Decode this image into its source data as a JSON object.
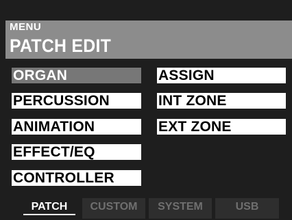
{
  "header": {
    "menu_label": "MENU",
    "page_title": "PATCH EDIT"
  },
  "menu": {
    "left": [
      {
        "label": "ORGAN",
        "selected": true
      },
      {
        "label": "PERCUSSION",
        "selected": false
      },
      {
        "label": "ANIMATION",
        "selected": false
      },
      {
        "label": "EFFECT/EQ",
        "selected": false
      },
      {
        "label": "CONTROLLER",
        "selected": false
      }
    ],
    "right": [
      {
        "label": "ASSIGN",
        "selected": false
      },
      {
        "label": "INT ZONE",
        "selected": false
      },
      {
        "label": "EXT ZONE",
        "selected": false
      }
    ]
  },
  "tabs": [
    {
      "label": "PATCH",
      "active": true
    },
    {
      "label": "CUSTOM",
      "active": false
    },
    {
      "label": "SYSTEM",
      "active": false
    },
    {
      "label": "USB",
      "active": false
    }
  ],
  "colors": {
    "background": "#1e1e1e",
    "header_bar": "#8c8c8c",
    "selected_item": "#777777",
    "item_background": "#ffffff",
    "inactive_tab": "#2e2e2e"
  }
}
